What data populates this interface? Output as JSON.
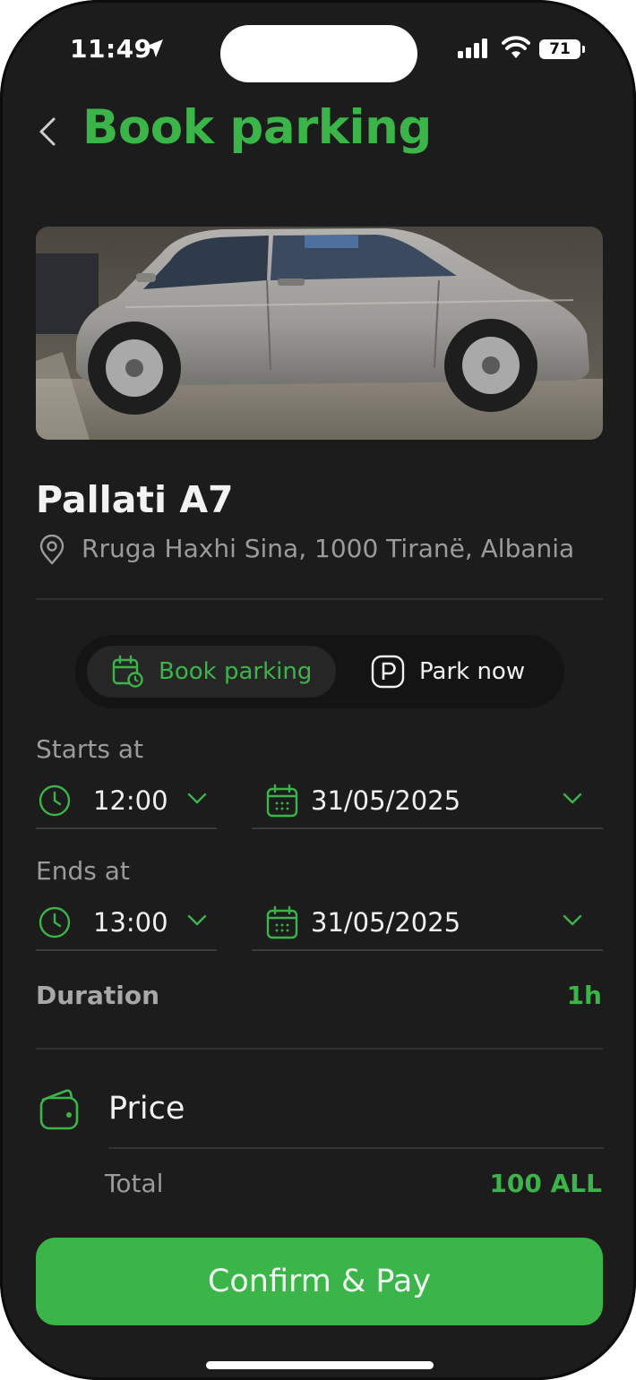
{
  "status_bar": {
    "time": "11:49",
    "battery": "71"
  },
  "header": {
    "title": "Book parking"
  },
  "venue": {
    "name": "Pallati A7",
    "address": "Rruga Haxhi Sina, 1000 Tiranë, Albania"
  },
  "mode_toggle": {
    "options": [
      {
        "label": "Book parking",
        "active": true
      },
      {
        "label": "Park now",
        "active": false
      }
    ]
  },
  "starts": {
    "label": "Starts at",
    "time": "12:00",
    "date": "31/05/2025"
  },
  "ends": {
    "label": "Ends at",
    "time": "13:00",
    "date": "31/05/2025"
  },
  "duration": {
    "label": "Duration",
    "value": "1h"
  },
  "price": {
    "title": "Price",
    "total_label": "Total",
    "total_value": "100 ALL"
  },
  "cta": {
    "label": "Confirm & Pay"
  },
  "colors": {
    "accent": "#3bb54a",
    "background": "#1c1c1c",
    "muted_text": "#9b9b9b"
  }
}
